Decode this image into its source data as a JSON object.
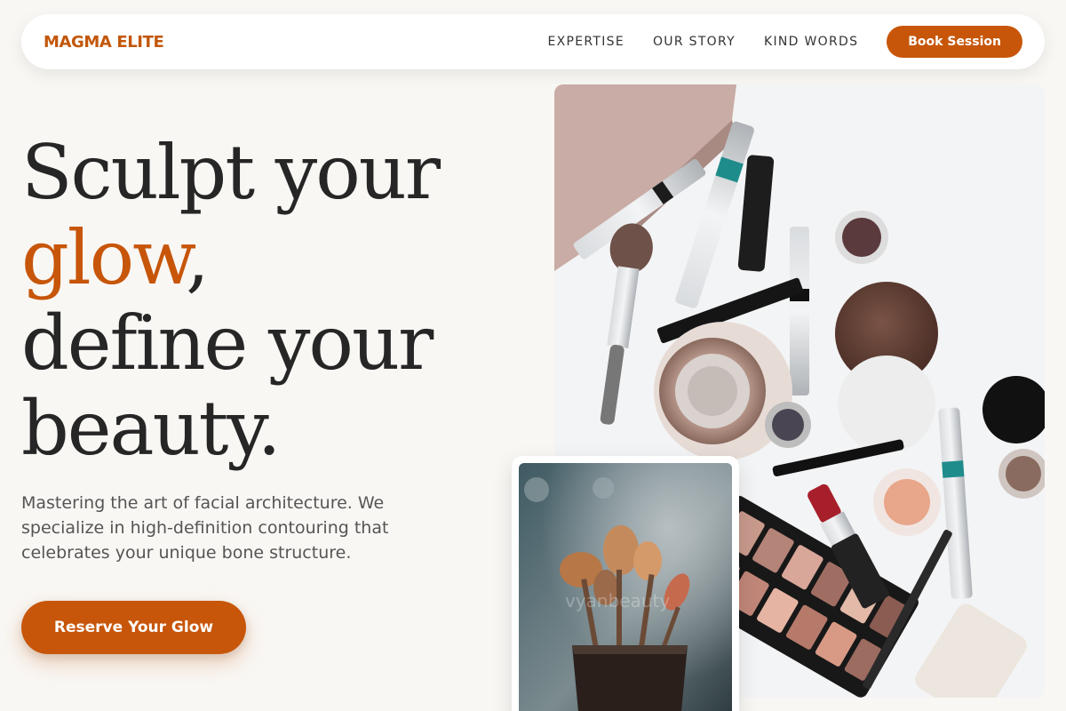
{
  "brand": {
    "name": "MAGMA ELITE",
    "color": "#c7560a"
  },
  "nav": {
    "links": [
      {
        "label": "EXPERTISE"
      },
      {
        "label": "OUR STORY"
      },
      {
        "label": "KIND WORDS"
      }
    ],
    "cta_label": "Book Session"
  },
  "hero": {
    "headline": {
      "line1": "Sculpt your",
      "accent_word": "glow",
      "after_accent": ",",
      "line3": "define your",
      "line4": "beauty."
    },
    "description": "Mastering the art of facial architecture. We specialize in high-definition contouring that celebrates your unique bone structure.",
    "cta_label": "Reserve Your Glow"
  },
  "images": {
    "main_icon": "makeup-flatlay-photo",
    "inset_icon": "makeup-brushes-photo",
    "inset_watermark": "vyanbeauty"
  },
  "colors": {
    "accent": "#c7560a",
    "background": "#f9f7f4",
    "text": "#262626"
  }
}
